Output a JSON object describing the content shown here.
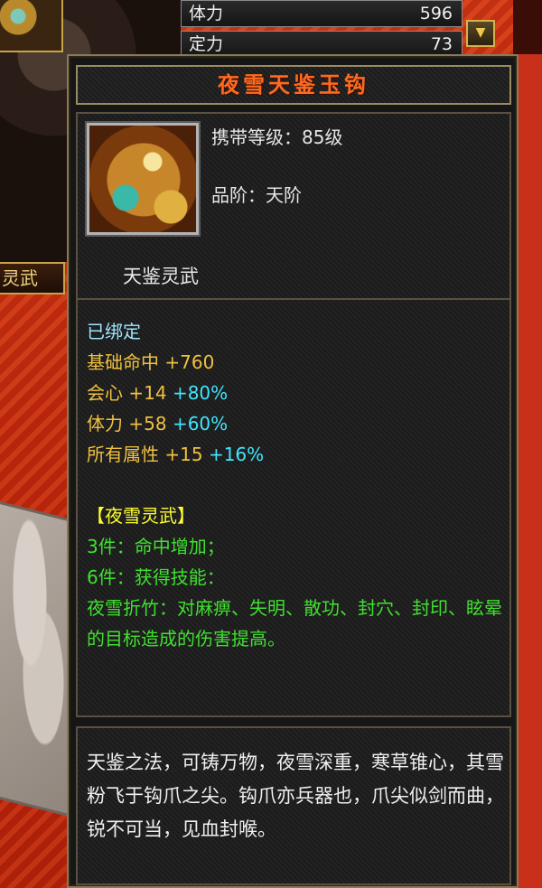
{
  "background": {
    "stat_rows": [
      {
        "label": "体力",
        "value": "596"
      },
      {
        "label": "定力",
        "value": "73"
      }
    ],
    "side_tab_label": "灵武"
  },
  "tooltip": {
    "title": "夜雪天鉴玉钩",
    "title_color": "#ff6a20",
    "level_line": "携带等级：85级",
    "grade_line": "品阶：天阶",
    "set_name": "天鉴灵武",
    "bound": "已绑定",
    "attributes": {
      "hit": {
        "label": "基础命中",
        "base": "+760"
      },
      "crit": {
        "label": "会心",
        "base": "+14",
        "pct": "+80%"
      },
      "stamina": {
        "label": "体力",
        "base": "+58",
        "pct": "+60%"
      },
      "all": {
        "label": "所有属性",
        "base": "+15",
        "pct": "+16%"
      }
    },
    "set": {
      "header": "【夜雪灵武】",
      "bonus_3": "3件：命中增加；",
      "bonus_6": "6件：获得技能：",
      "skill": "夜雪折竹：对麻痹、失明、散功、封穴、封印、眩晕的目标造成的伤害提高。"
    },
    "description": "天鉴之法，可铸万物，夜雪深重，寒草锥心，其雪粉飞于钩爪之尖。钩爪亦兵器也，爪尖似剑而曲，锐不可当，见血封喉。"
  },
  "colors": {
    "bound": "#9ee6ff",
    "gold": "#f0c040",
    "cyan": "#40e6ff",
    "set_header": "#ffff30",
    "set_text": "#40e030"
  }
}
